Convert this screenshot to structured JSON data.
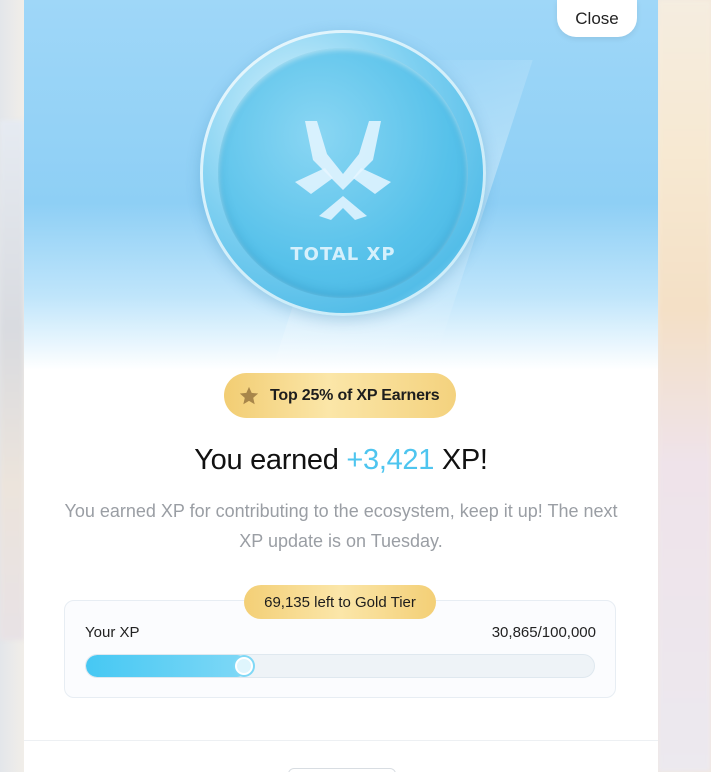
{
  "modal": {
    "close_label": "Close",
    "coin_text": "TOTAL XP",
    "badge_label": "Top 25% of XP Earners",
    "headline_prefix": "You earned",
    "headline_amount": "+3,421",
    "headline_suffix": "XP!",
    "description": "You earned XP for contributing to the ecosystem, keep it up! The next XP update is on Tuesday.",
    "tier_pill": "69,135 left to Gold Tier",
    "xp_label": "Your XP",
    "xp_value": "30,865/100,000",
    "progress_fraction": 0.30865
  },
  "colors": {
    "accent": "#4ec5ef",
    "gold": "#f3cf76",
    "hero_sky": "#8ecff5"
  },
  "icons": {
    "coin_logo": "total-xp-logo-icon",
    "badge": "star-icon"
  }
}
